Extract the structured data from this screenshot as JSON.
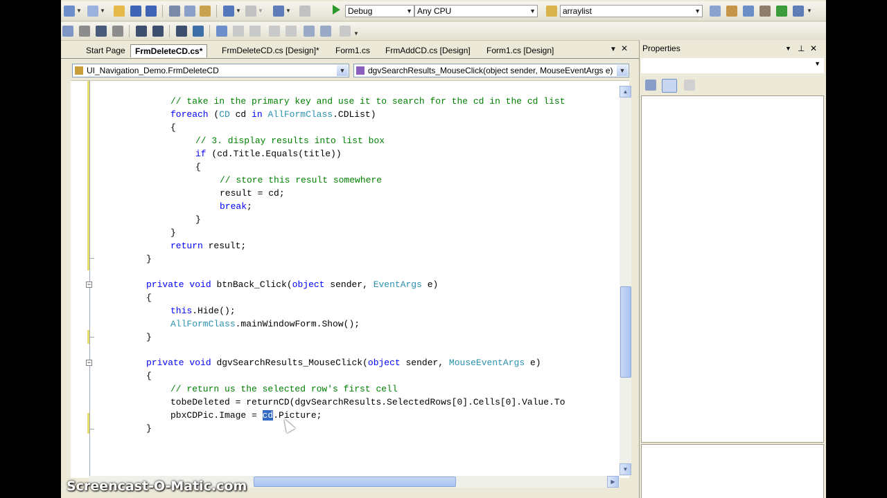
{
  "toolbar": {
    "configuration": "Debug",
    "platform": "Any CPU",
    "find_text": "arraylist"
  },
  "tabs": [
    {
      "label": "Start Page",
      "active": false
    },
    {
      "label": "FrmDeleteCD.cs*",
      "active": true
    },
    {
      "label": "FrmDeleteCD.cs [Design]*",
      "active": false
    },
    {
      "label": "Form1.cs",
      "active": false
    },
    {
      "label": "FrmAddCD.cs [Design]",
      "active": false
    },
    {
      "label": "Form1.cs [Design]",
      "active": false
    }
  ],
  "tab_controls": {
    "dropdown": "▼",
    "close": "✕"
  },
  "navigation": {
    "class_combo": "UI_Navigation_Demo.FrmDeleteCD",
    "member_combo": "dgvSearchResults_MouseClick(object sender, MouseEventArgs e)"
  },
  "code": {
    "line_01": "// take in the primary key and use it to search for the cd in the cd list",
    "line_02_kw": "foreach",
    "line_02_a": " (",
    "line_02_ty": "CD",
    "line_02_b": " cd ",
    "line_02_kw2": "in",
    "line_02_ty2": "AllFormClass",
    "line_02_c": ".CDList)",
    "line_03": "{",
    "line_04": "// 3. display results into list box",
    "line_05_kw": "if",
    "line_05_a": " (cd.Title.Equals(title))",
    "line_06": "{",
    "line_07": "// store this result somewhere",
    "line_08": "result = cd;",
    "line_09_kw": "break",
    "line_09_a": ";",
    "line_10": "}",
    "line_11": "}",
    "line_12_kw": "return",
    "line_12_a": " result;",
    "line_13": "}",
    "line_15_kw": "private",
    "line_15_kw2": "void",
    "line_15_a": " btnBack_Click(",
    "line_15_kw3": "object",
    "line_15_b": " sender, ",
    "line_15_ty": "EventArgs",
    "line_15_c": " e)",
    "line_16": "{",
    "line_17_kw": "this",
    "line_17_a": ".Hide();",
    "line_18_ty": "AllFormClass",
    "line_18_a": ".mainWindowForm.Show();",
    "line_19": "}",
    "line_21_kw": "private",
    "line_21_kw2": "void",
    "line_21_a": " dgvSearchResults_MouseClick(",
    "line_21_kw3": "object",
    "line_21_b": " sender, ",
    "line_21_ty": "MouseEventArgs",
    "line_21_c": " e)",
    "line_22": "{",
    "line_23": "// return us the selected row's first cell",
    "line_24": "tobeDeleted = returnCD(dgvSearchResults.SelectedRows[0].Cells[0].Value.To",
    "line_25_a": "pbxCDPic.Image = ",
    "line_25_sel": "cd",
    "line_25_b": ".Picture;",
    "line_26": "}"
  },
  "properties": {
    "title": "Properties"
  },
  "watermark": "Screencast-O-Matic.com"
}
